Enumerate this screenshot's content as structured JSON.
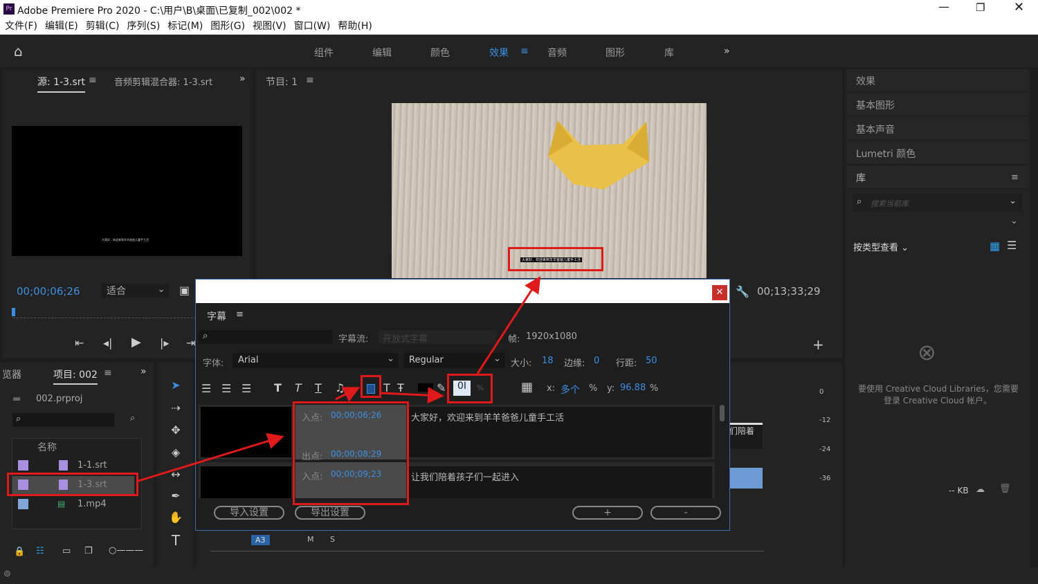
{
  "window": {
    "title": "Adobe Premiere Pro 2020 - C:\\用户\\B\\桌面\\已复制_002\\002 *",
    "app_icon": "Pr"
  },
  "menu": [
    "文件(F)",
    "编辑(E)",
    "剪辑(C)",
    "序列(S)",
    "标记(M)",
    "图形(G)",
    "视图(V)",
    "窗口(W)",
    "帮助(H)"
  ],
  "workspaces": [
    "组件",
    "编辑",
    "颜色",
    "效果",
    "音频",
    "图形",
    "库"
  ],
  "active_workspace": "效果",
  "source": {
    "tab": "源: 1-3.srt",
    "tab2": "音频剪辑混合器: 1-3.srt",
    "timecode": "00;00;06;26",
    "fit": "适合",
    "subtitle_preview": "大家好，欢迎来到羊羊爸爸儿童手工活"
  },
  "program": {
    "tab": "节目: 1",
    "timecode": "00;13;33;29"
  },
  "right_panel": {
    "items": [
      "效果",
      "基本图形",
      "基本声音",
      "Lumetri 颜色",
      "库"
    ],
    "search_placeholder": "搜索当前库",
    "view_by": "按类型查看",
    "cc_message_1": "要使用 Creative Cloud Libraries，您需要",
    "cc_message_2": "登录 Creative Cloud 帐户。",
    "size": "-- KB"
  },
  "project": {
    "tab_prev": "览器",
    "tab": "项目: 002",
    "file": "002.prproj",
    "column": "名称",
    "items": [
      {
        "name": "1-1.srt",
        "color": "#a98fe0"
      },
      {
        "name": "1-3.srt",
        "color": "#a98fe0"
      },
      {
        "name": "1.mp4",
        "color": "#7fa8d8"
      }
    ]
  },
  "captions": {
    "title": "字幕",
    "stream_label": "字幕流:",
    "stream_value": "开放式字幕",
    "frame_label": "帧:",
    "frame_value": "1920x1080",
    "font_label": "字体:",
    "font": "Arial",
    "style": "Regular",
    "size_label": "大小:",
    "size": "18",
    "edge_label": "边缘:",
    "edge": "0",
    "leading_label": "行距:",
    "leading": "50",
    "x_label": "x:",
    "x": "多个",
    "y_label": "y:",
    "y": "96.88",
    "pct": "%",
    "rows": [
      {
        "in_label": "入点:",
        "in": "00;00;06;26",
        "out_label": "出点:",
        "out": "00;00;08;29",
        "text": "大家好，欢迎来到羊羊爸爸儿童手工活"
      },
      {
        "in_label": "入点:",
        "in": "00;00;09;23",
        "text": "让我们陪着孩子们一起进入"
      }
    ],
    "import": "导入设置",
    "export": "导出设置",
    "add": "+",
    "remove": "-"
  },
  "timeline": {
    "track": "A3",
    "m": "M",
    "s": "S",
    "clip": "们陪着",
    "meter": [
      "0",
      "-12",
      "-24",
      "-36"
    ]
  }
}
